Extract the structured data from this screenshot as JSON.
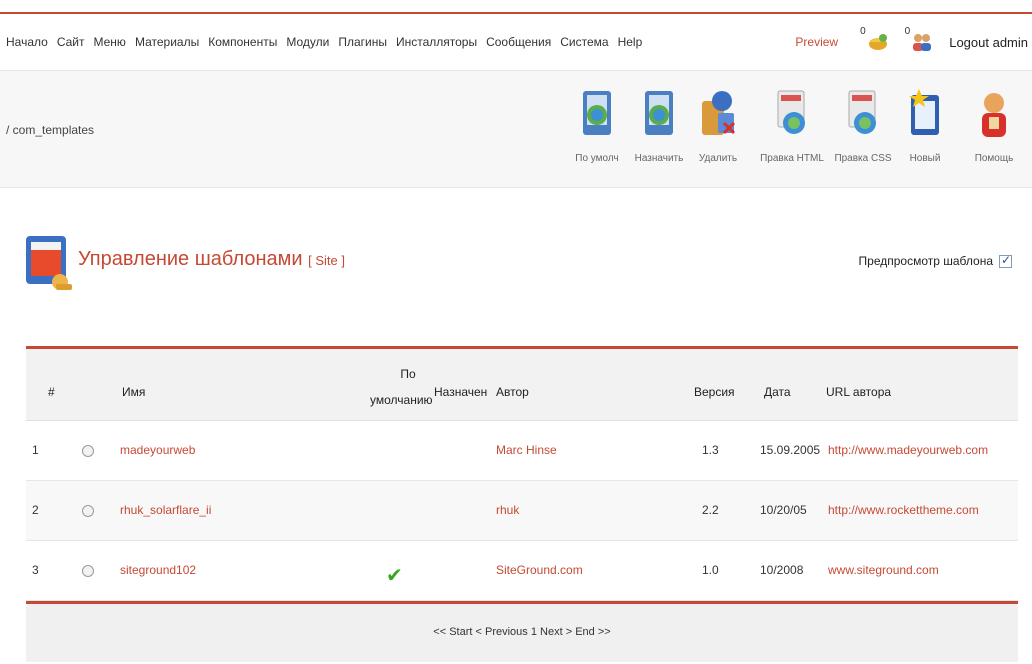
{
  "menu": [
    "Начало",
    "Сайт",
    "Меню",
    "Материалы",
    "Компоненты",
    "Модули",
    "Плагины",
    "Инсталляторы",
    "Сообщения",
    "Система",
    "Help"
  ],
  "header": {
    "preview": "Preview",
    "messages_count": "0",
    "users_count": "0",
    "logout": "Logout admin"
  },
  "breadcrumb": "/ com_templates",
  "toolbar": [
    {
      "label": "По умолч",
      "icon": "default-icon"
    },
    {
      "label": "Назначить",
      "icon": "assign-icon"
    },
    {
      "label": "Удалить",
      "icon": "delete-icon"
    },
    {
      "label": "Правка HTML",
      "icon": "edit-html-icon"
    },
    {
      "label": "Правка CSS",
      "icon": "edit-css-icon"
    },
    {
      "label": "Новый",
      "icon": "new-icon"
    },
    {
      "label": "Помощь",
      "icon": "help-icon"
    }
  ],
  "page": {
    "title": "Управление шаблонами",
    "subtitle": "[ Site ]",
    "preview_toggle_label": "Предпросмотр шаблона",
    "preview_checked": true
  },
  "table": {
    "columns": {
      "num": "#",
      "name": "Имя",
      "default_line1": "По",
      "default_line2": "умолчанию",
      "assigned": "Назначен",
      "author": "Автор",
      "version": "Версия",
      "date": "Дата",
      "url": "URL автора"
    },
    "rows": [
      {
        "num": "1",
        "name": "madeyourweb",
        "is_default": false,
        "author": "Marc Hinse",
        "version": "1.3",
        "date": "15.09.2005",
        "url": "http://www.madeyourweb.com"
      },
      {
        "num": "2",
        "name": "rhuk_solarflare_ii",
        "is_default": false,
        "author": "rhuk",
        "version": "2.2",
        "date": "10/20/05",
        "url": "http://www.rockettheme.com"
      },
      {
        "num": "3",
        "name": "siteground102",
        "is_default": true,
        "author": "SiteGround.com",
        "version": "1.0",
        "date": "10/2008",
        "url": "www.siteground.com"
      }
    ]
  },
  "pager": {
    "start": "<< Start",
    "previous": "< Previous",
    "page": "1",
    "next": "Next >",
    "end": "End >>"
  },
  "colors": {
    "accent": "#c64934",
    "check": "#3aa51d"
  }
}
